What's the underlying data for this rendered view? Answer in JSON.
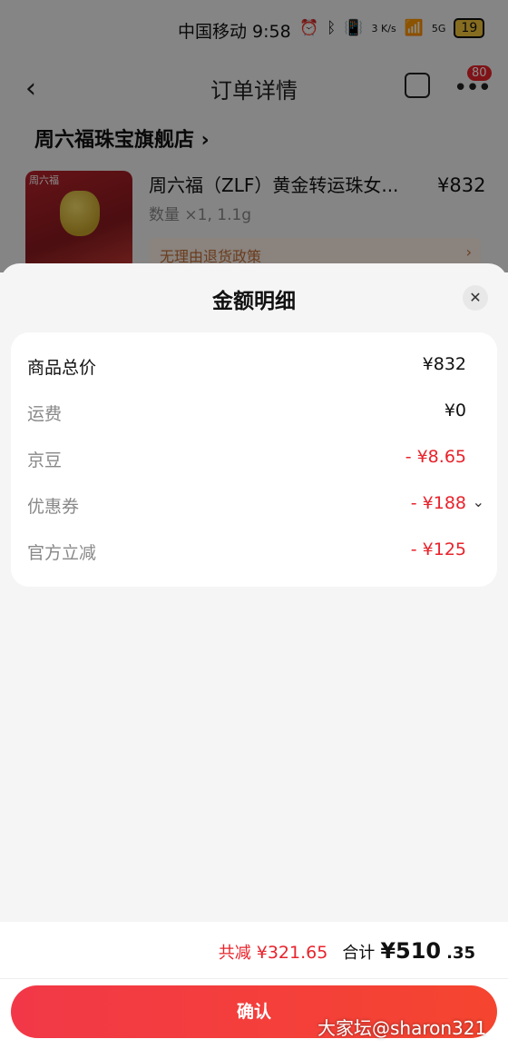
{
  "status_bar": {
    "carrier_time": "中国移动 9:58",
    "net_speed": "3 K/s",
    "signal": "5G",
    "battery": "19"
  },
  "nav": {
    "title": "订单详情",
    "badge": "80"
  },
  "order": {
    "shop_name": "周六福珠宝旗舰店",
    "product_title": "周六福（ZLF）黄金转运珠女...",
    "product_price": "¥832",
    "product_qty": "数量 ×1, 1.1g",
    "return_policy": "无理由退货政策"
  },
  "sheet": {
    "title": "金额明细",
    "rows": [
      {
        "label": "商品总价",
        "value": "¥832"
      },
      {
        "label": "运费",
        "value": "¥0"
      },
      {
        "label": "京豆",
        "value": "- ¥8.65"
      },
      {
        "label": "优惠券",
        "value": "- ¥188"
      },
      {
        "label": "官方立减",
        "value": "- ¥125"
      }
    ]
  },
  "footer": {
    "saved_label": "共减",
    "saved_value": "¥321.65",
    "sum_label": "合计",
    "sum_value": "¥510",
    "sum_decimal": ".35",
    "confirm_label": "确认"
  },
  "watermark": "大家坛@sharon321"
}
